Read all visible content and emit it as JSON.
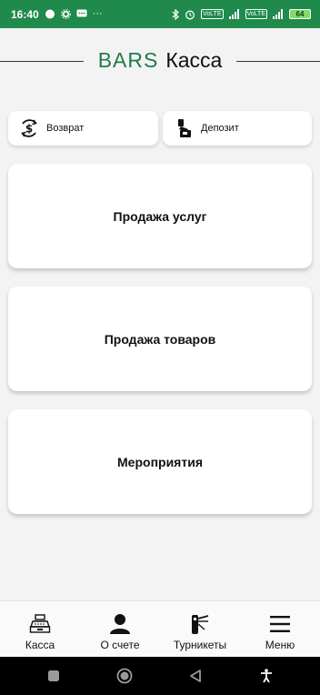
{
  "status_bar": {
    "time": "16:40",
    "more": "···",
    "battery": "64",
    "net_label_1": "VoLTE",
    "net_label_2": "VoLTE"
  },
  "header": {
    "brand": "BARS",
    "product": "Касса",
    "brand_color": "#1e7d4a"
  },
  "actions": {
    "refund_label": "Возврат",
    "deposit_label": "Депозит"
  },
  "tiles": {
    "services": "Продажа услуг",
    "goods": "Продажа товаров",
    "events": "Мероприятия"
  },
  "bottom_nav": {
    "items": [
      {
        "label": "Касса",
        "icon": "cash-register-icon"
      },
      {
        "label": "О счете",
        "icon": "person-icon"
      },
      {
        "label": "Турникеты",
        "icon": "turnstile-icon"
      },
      {
        "label": "Меню",
        "icon": "hamburger-menu-icon"
      }
    ]
  },
  "colors": {
    "status_bar": "#1f8a4c",
    "background": "#f4f3f3"
  }
}
